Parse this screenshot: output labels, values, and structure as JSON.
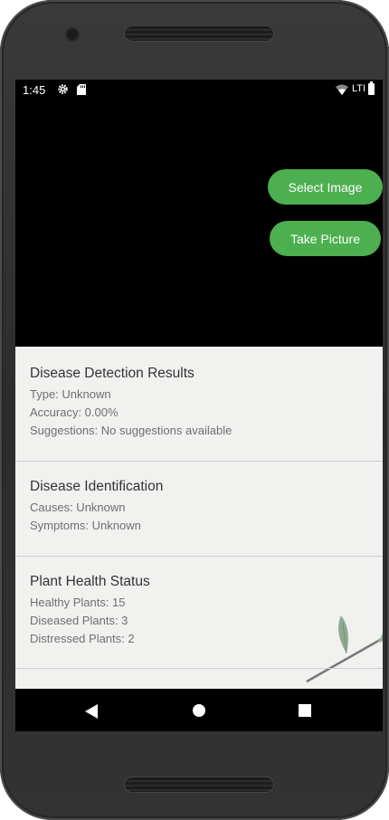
{
  "status_bar": {
    "time": "1:45",
    "network": "LTI"
  },
  "actions": {
    "select_image": "Select Image",
    "take_picture": "Take Picture",
    "accent_color": "#4caf50"
  },
  "cards": {
    "detection": {
      "title": "Disease Detection Results",
      "type": "Type: Unknown",
      "accuracy": "Accuracy: 0.00%",
      "suggestions": "Suggestions: No suggestions available"
    },
    "identification": {
      "title": "Disease Identification",
      "causes": "Causes: Unknown",
      "symptoms": "Symptoms: Unknown"
    },
    "health": {
      "title": "Plant Health Status",
      "healthy": "Healthy Plants: 15",
      "diseased": "Diseased Plants: 3",
      "distressed": "Distressed Plants: 2"
    }
  },
  "nav": {
    "back": "back-icon",
    "home": "home-icon",
    "recent": "recent-apps-icon"
  }
}
